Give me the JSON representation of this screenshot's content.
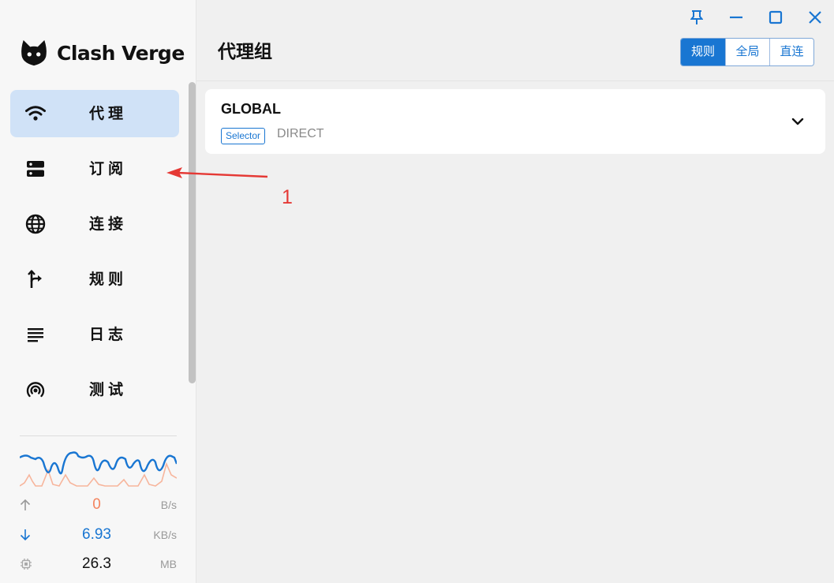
{
  "app": {
    "name": "Clash Verge",
    "logo_icon": "cat-icon"
  },
  "window_controls": [
    {
      "name": "pin",
      "icon": "pin-icon"
    },
    {
      "name": "minimize",
      "icon": "minimize-icon"
    },
    {
      "name": "maximize",
      "icon": "maximize-icon"
    },
    {
      "name": "close",
      "icon": "close-icon"
    }
  ],
  "sidebar": {
    "items": [
      {
        "label": "代理",
        "icon": "wifi-icon",
        "active": true
      },
      {
        "label": "订阅",
        "icon": "dns-icon",
        "active": false
      },
      {
        "label": "连接",
        "icon": "globe-icon",
        "active": false
      },
      {
        "label": "规则",
        "icon": "fork-arrow-icon",
        "active": false
      },
      {
        "label": "日志",
        "icon": "text-lines-icon",
        "active": false
      },
      {
        "label": "测试",
        "icon": "radar-icon",
        "active": false
      }
    ]
  },
  "traffic": {
    "upload": {
      "value": "0",
      "unit": "B/s",
      "icon": "arrow-up-icon",
      "color": "#f4845f"
    },
    "download": {
      "value": "6.93",
      "unit": "KB/s",
      "icon": "arrow-down-icon",
      "color": "#1976d2"
    },
    "memory": {
      "value": "26.3",
      "unit": "MB",
      "icon": "memory-chip-icon",
      "color": "#111111"
    },
    "graph_colors": {
      "download": "#1976d2",
      "upload": "#f7b59c"
    }
  },
  "main": {
    "title": "代理组",
    "modes": [
      {
        "label": "规则",
        "selected": true
      },
      {
        "label": "全局",
        "selected": false
      },
      {
        "label": "直连",
        "selected": false
      }
    ],
    "groups": [
      {
        "name": "GLOBAL",
        "type": "Selector",
        "now": "DIRECT",
        "expand_icon": "chevron-down-icon"
      }
    ]
  },
  "annotation": {
    "label": "1",
    "color": "#e53935"
  },
  "colors": {
    "accent": "#1976d2",
    "active_nav_bg": "#d0e2f7"
  }
}
